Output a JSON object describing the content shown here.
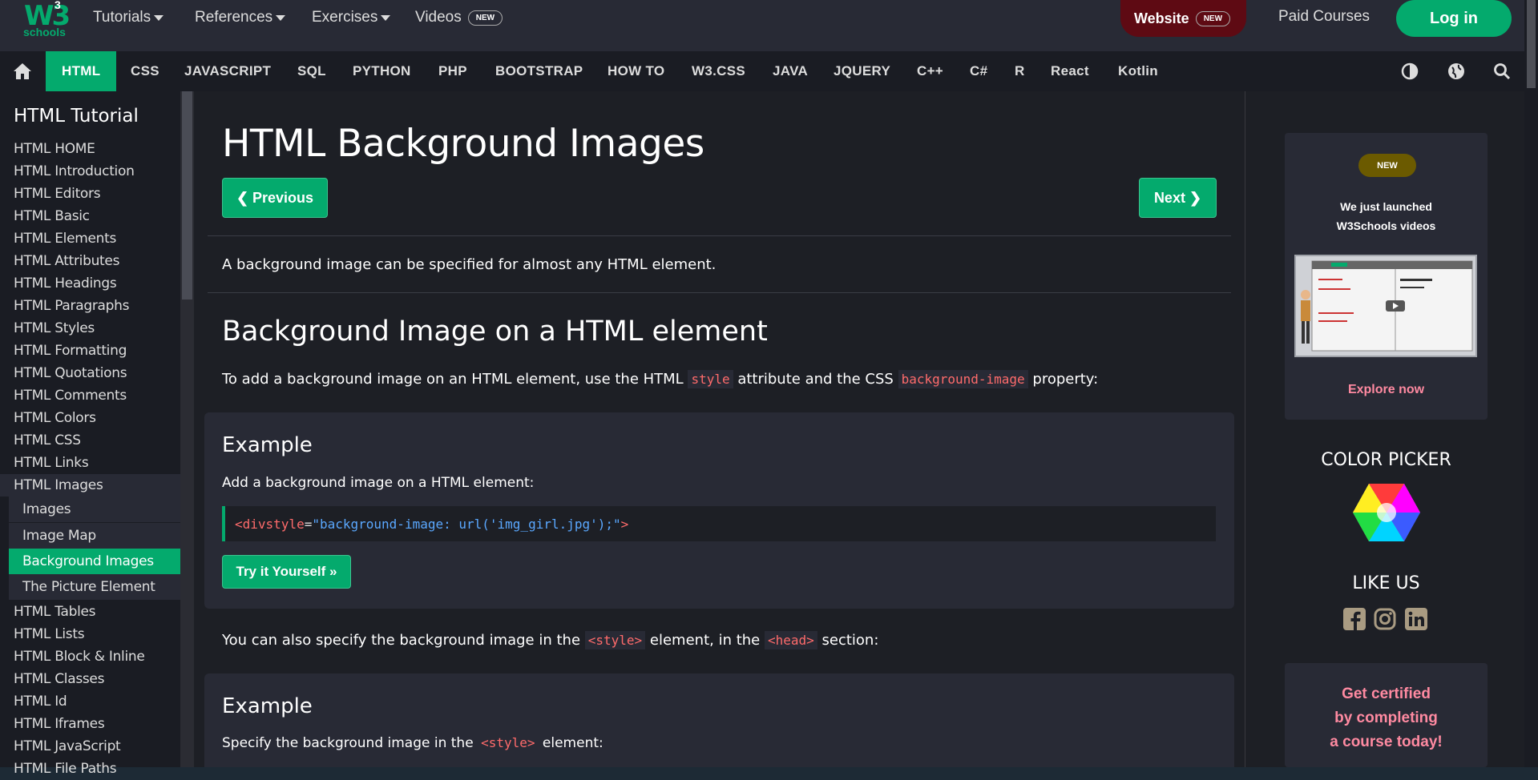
{
  "topbar": {
    "logo_main": "W3",
    "logo_sup": "3",
    "logo_sub": "schools",
    "menus": [
      "Tutorials",
      "References",
      "Exercises"
    ],
    "videos_label": "Videos",
    "new_badge": "NEW",
    "website_label": "Website",
    "paid_courses": "Paid Courses",
    "login": "Log in"
  },
  "navbar": {
    "items": [
      "HTML",
      "CSS",
      "JAVASCRIPT",
      "SQL",
      "PYTHON",
      "PHP",
      "BOOTSTRAP",
      "HOW TO",
      "W3.CSS",
      "JAVA",
      "JQUERY",
      "C++",
      "C#",
      "R",
      "React",
      "Kotlin"
    ],
    "active": "HTML"
  },
  "sidebar": {
    "title": "HTML Tutorial",
    "items_top": [
      "HTML HOME",
      "HTML Introduction",
      "HTML Editors",
      "HTML Basic",
      "HTML Elements",
      "HTML Attributes",
      "HTML Headings",
      "HTML Paragraphs",
      "HTML Styles",
      "HTML Formatting",
      "HTML Quotations",
      "HTML Comments",
      "HTML Colors",
      "HTML CSS",
      "HTML Links",
      "HTML Images"
    ],
    "subitems": [
      "Images",
      "Image Map",
      "Background Images",
      "The Picture Element"
    ],
    "items_bottom": [
      "HTML Tables",
      "HTML Lists",
      "HTML Block & Inline",
      "HTML Classes",
      "HTML Id",
      "HTML Iframes",
      "HTML JavaScript",
      "HTML File Paths"
    ]
  },
  "main": {
    "title": "HTML Background Images",
    "prev": "❮ Previous",
    "next": "Next ❯",
    "intro": "A background image can be specified for almost any HTML element.",
    "section_title": "Background Image on a HTML element",
    "section_p1_a": "To add a background image on an HTML element, use the HTML ",
    "section_p1_code1": "style",
    "section_p1_b": " attribute and the CSS ",
    "section_p1_code2": "background-image",
    "section_p1_c": " property:",
    "example1": {
      "heading": "Example",
      "desc": "Add a background image on a HTML element:",
      "code_tag": "<div",
      "code_attr": " style",
      "code_eq": "=",
      "code_val": "\"background-image: url('img_girl.jpg');\"",
      "code_close": ">",
      "try_btn": "Try it Yourself »"
    },
    "p2_a": "You can also specify the background image in the ",
    "p2_code1": "<style>",
    "p2_b": " element, in the ",
    "p2_code2": "<head>",
    "p2_c": " section:",
    "example2": {
      "heading": "Example",
      "desc_a": "Specify the background image in the ",
      "desc_code": "<style>",
      "desc_b": " element:"
    }
  },
  "right": {
    "promo_badge": "NEW",
    "promo_line1": "We just launched",
    "promo_line2": "W3Schools videos",
    "promo_link": "Explore now",
    "color_picker": "COLOR PICKER",
    "like_us": "LIKE US",
    "cert_line1": "Get certified",
    "cert_line2": "by completing",
    "cert_line3": "a course today!"
  },
  "colors": {
    "accent": "#04aa6d",
    "code_red": "#ff6b6b",
    "code_blue": "#5aa8ff",
    "pink": "#ff8aa1"
  }
}
